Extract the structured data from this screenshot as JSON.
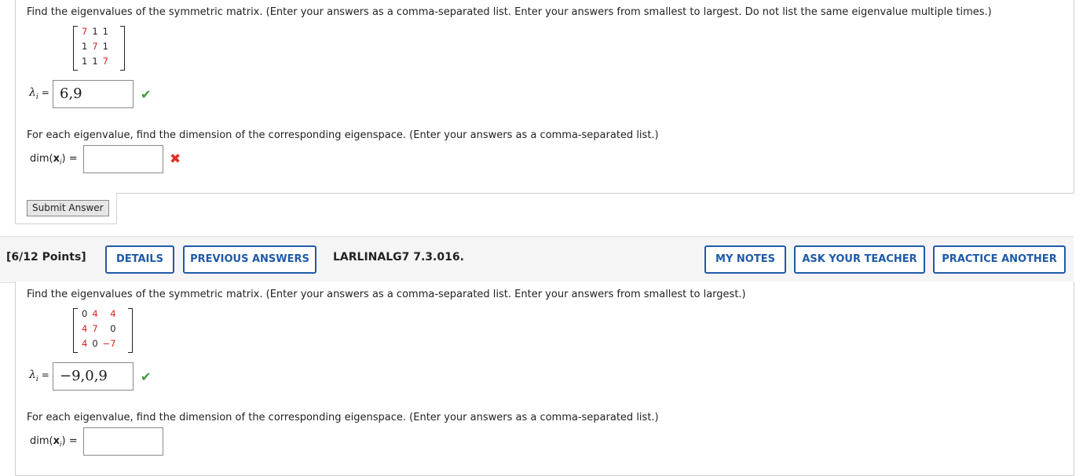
{
  "q1": {
    "prompt": "Find the eigenvalues of the symmetric matrix. (Enter your answers as a comma-separated list. Enter your answers from smallest to largest. Do not list the same eigenvalue multiple times.)",
    "matrix": [
      [
        "7",
        "1",
        "1"
      ],
      [
        "1",
        "7",
        "1"
      ],
      [
        "1",
        "1",
        "7"
      ]
    ],
    "lambda_label": "λ",
    "lambda_sub": "i",
    "equals": "=",
    "eigen_answer": "6,9",
    "eigen_status": "correct",
    "dim_prompt": "For each eigenvalue, find the dimension of the corresponding eigenspace. (Enter your answers as a comma-separated list.)",
    "dim_label_pre": "dim(",
    "dim_label_x": "x",
    "dim_label_sub": "i",
    "dim_label_post": ") =",
    "dim_answer": "",
    "dim_status": "incorrect",
    "submit_label": "Submit Answer"
  },
  "q2": {
    "points": "[6/12 Points]",
    "details_label": "DETAILS",
    "previous_label": "PREVIOUS ANSWERS",
    "problem_code": "LARLINALG7 7.3.016.",
    "my_notes_label": "MY NOTES",
    "ask_teacher_label": "ASK YOUR TEACHER",
    "practice_label": "PRACTICE ANOTHER",
    "prompt": "Find the eigenvalues of the symmetric matrix. (Enter your answers as a comma-separated list. Enter your answers from smallest to largest.)",
    "matrix": [
      [
        "0",
        "4",
        "4"
      ],
      [
        "4",
        "7",
        "0"
      ],
      [
        "4",
        "0",
        "−7"
      ]
    ],
    "lambda_label": "λ",
    "lambda_sub": "i",
    "equals": "=",
    "eigen_answer": "−9,0,9",
    "eigen_status": "correct",
    "dim_prompt": "For each eigenvalue, find the dimension of the corresponding eigenspace. (Enter your answers as a comma-separated list.)",
    "dim_label_pre": "dim(",
    "dim_label_x": "x",
    "dim_label_sub": "i",
    "dim_label_post": ") =",
    "dim_answer": ""
  },
  "icons": {
    "check": "check-icon",
    "cross": "cross-icon"
  },
  "colors": {
    "accent": "#1e5aa8",
    "correct": "#3a9a3a",
    "incorrect": "#e0302a",
    "matrix_highlight": "#dd2222"
  }
}
